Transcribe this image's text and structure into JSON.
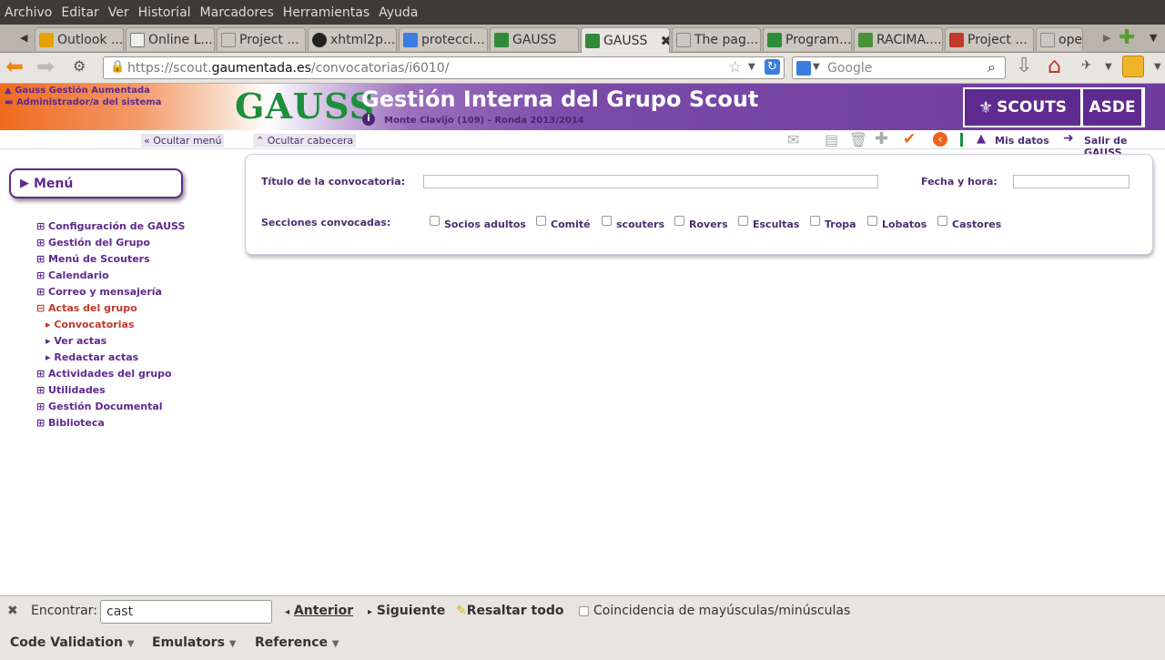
{
  "menubar": [
    "Archivo",
    "Editar",
    "Ver",
    "Historial",
    "Marcadores",
    "Herramientas",
    "Ayuda"
  ],
  "tabs": [
    {
      "label": "Outlook ...",
      "color": "#e8a000"
    },
    {
      "label": "Online L...",
      "color": "#777777"
    },
    {
      "label": "Project ...",
      "color": "#888888"
    },
    {
      "label": "xhtml2p...",
      "color": "#222222"
    },
    {
      "label": "protecci...",
      "color": "#3b7de0"
    },
    {
      "label": "GAUSS",
      "color": "#2e8b3a"
    },
    {
      "label": "GAUSS",
      "color": "#2e8b3a"
    },
    {
      "label": "The pag...",
      "color": "#888888"
    },
    {
      "label": "Program...",
      "color": "#2e8b3a"
    },
    {
      "label": "RACIMA....",
      "color": "#4a8f3a"
    },
    {
      "label": "Project ...",
      "color": "#c0392b"
    },
    {
      "label": "ope",
      "color": "#888888"
    }
  ],
  "nav": {
    "url_prefix": "https://scout.",
    "url_domain": "gaumentada.es",
    "url_path": "/convocatorias/i6010/",
    "search_placeholder": "Google"
  },
  "header": {
    "user_app": "Gauss Gestión Aumentada",
    "user_role": "Administrador/a del sistema",
    "logo": "GAUSS",
    "title": "Gestión Interna del Grupo Scout",
    "subtitle": "Monte Clavijo (109) - Ronda 2013/2014",
    "scouts": "SCOUTS",
    "asde": "ASDE"
  },
  "toolrow": {
    "hide_menu": "Ocultar menú",
    "hide_header": "Ocultar cabecera",
    "my_data": "Mis datos",
    "exit": "Salir de GAUSS"
  },
  "sidebar": {
    "menu_title": "Menú",
    "items": [
      "Configuración de GAUSS",
      "Gestión del Grupo",
      "Menú de Scouters",
      "Calendario",
      "Correo y mensajería",
      "Actas del grupo"
    ],
    "subitems": [
      "Convocatorias",
      "Ver actas",
      "Redactar actas"
    ],
    "items_after": [
      "Actividades del grupo",
      "Utilidades",
      "Gestión Documental",
      "Biblioteca"
    ]
  },
  "form": {
    "title_label": "Título de la convocatoria:",
    "date_label": "Fecha y hora:",
    "sections_label": "Secciones convocadas:",
    "sections": [
      "Socios adultos",
      "Comité",
      "scouters",
      "Rovers",
      "Escultas",
      "Tropa",
      "Lobatos",
      "Castores"
    ]
  },
  "findbar": {
    "label": "Encontrar:",
    "value": "cast",
    "prev": "Anterior",
    "next": "Siguiente",
    "highlight": "Resaltar todo",
    "match_case": "Coincidencia de mayúsculas/minúsculas"
  },
  "addons": [
    "Code Validation",
    "Emulators",
    "Reference"
  ]
}
